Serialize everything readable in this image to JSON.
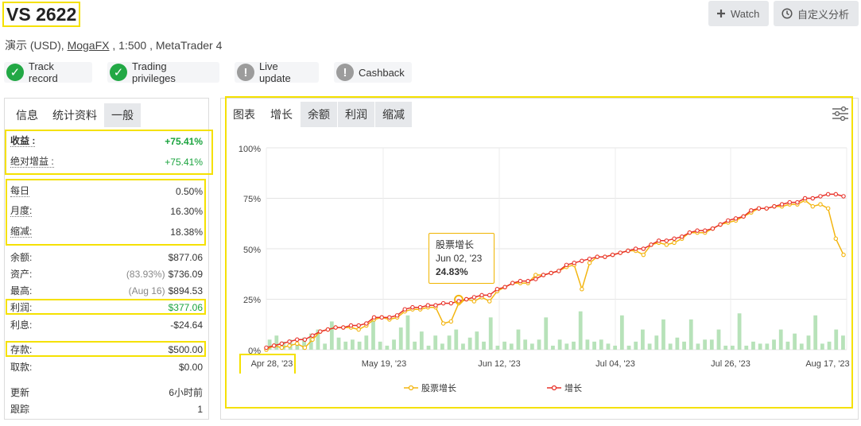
{
  "header": {
    "title": "VS 2622",
    "subtitle_prefix": "演示 (USD), ",
    "broker": "MogaFX",
    "subtitle_suffix": " , 1:500 , MetaTrader 4",
    "watch_label": "Watch",
    "analyze_label": "自定义分析"
  },
  "badges": [
    {
      "label": "Track record",
      "status": "ok"
    },
    {
      "label": "Trading privileges",
      "status": "ok"
    },
    {
      "label": "Live update",
      "status": "warn"
    },
    {
      "label": "Cashback",
      "status": "warn"
    }
  ],
  "left_tabs": [
    "信息",
    "统计资料",
    "一般"
  ],
  "stats": {
    "gain": {
      "label": "收益 :",
      "value": "+75.41%"
    },
    "abs_gain": {
      "label": "绝对增益 :",
      "value": "+75.41%"
    },
    "daily": {
      "label": "每日",
      "value": "0.50%"
    },
    "monthly": {
      "label": "月度:",
      "value": "16.30%"
    },
    "drawdown": {
      "label": "缩减:",
      "value": "18.38%"
    },
    "balance": {
      "label": "余额:",
      "value": "$877.06"
    },
    "equity": {
      "label": "资产:",
      "muted": "(83.93%)",
      "value": "$736.09"
    },
    "highest": {
      "label": "最高:",
      "muted": "(Aug 16)",
      "value": "$894.53"
    },
    "profit": {
      "label": "利润:",
      "value": "$377.06"
    },
    "interest": {
      "label": "利息:",
      "value": "-$24.64"
    },
    "deposits": {
      "label": "存款:",
      "value": "$500.00"
    },
    "withdrawals": {
      "label": "取款:",
      "value": "$0.00"
    },
    "updated": {
      "label": "更新",
      "value": "6小时前"
    },
    "tracking": {
      "label": "跟踪",
      "value": "1"
    }
  },
  "right_tabs": [
    "图表",
    "增长",
    "余额",
    "利润",
    "缩减"
  ],
  "tooltip": {
    "title": "股票增长",
    "date": "Jun 02, '23",
    "value": "24.83%"
  },
  "colors": {
    "growth": "#e8322a",
    "equity": "#f3b511",
    "bars": "#b7e2b9",
    "highlight": "#f5e100",
    "green": "#1aa33e"
  },
  "chart_data": {
    "type": "line",
    "y_ticks": [
      "100%",
      "75%",
      "50%",
      "25%",
      "0%"
    ],
    "ylim": [
      0,
      100
    ],
    "x_tick_labels": [
      "Apr 28, '23",
      "May 19, '23",
      "Jun 12, '23",
      "Jul 04, '23",
      "Jul 26, '23",
      "Aug 17, '23"
    ],
    "legend": [
      "股票增长",
      "增长"
    ],
    "series": [
      {
        "name": "增长",
        "values": [
          1,
          2,
          3,
          4,
          5,
          5,
          7,
          9,
          10,
          11,
          11,
          12,
          12,
          13,
          16,
          16,
          16,
          17,
          20,
          21,
          21,
          22,
          22,
          23,
          23,
          24,
          25,
          26,
          27,
          27,
          30,
          31,
          33,
          34,
          34,
          35,
          37,
          38,
          39,
          42,
          43,
          44,
          45,
          46,
          46,
          47,
          48,
          49,
          50,
          50,
          52,
          54,
          54,
          55,
          56,
          58,
          59,
          59,
          60,
          62,
          64,
          65,
          66,
          69,
          70,
          70,
          71,
          72,
          73,
          73,
          75,
          75,
          76,
          77,
          77,
          76
        ]
      },
      {
        "name": "股票增长",
        "values": [
          0,
          2,
          1,
          2,
          3,
          1,
          5,
          9,
          10,
          11,
          11,
          11,
          10,
          12,
          15,
          16,
          15,
          16,
          19,
          20,
          20,
          21,
          21,
          13,
          14,
          23,
          25,
          24,
          26,
          24,
          29,
          31,
          33,
          33,
          33,
          37,
          37,
          38,
          39,
          41,
          42,
          30,
          43,
          46,
          46,
          47,
          48,
          49,
          49,
          47,
          52,
          53,
          52,
          53,
          55,
          58,
          58,
          58,
          60,
          62,
          63,
          64,
          66,
          68,
          70,
          70,
          71,
          71,
          72,
          72,
          74,
          71,
          72,
          70,
          55,
          47
        ]
      }
    ],
    "bars": [
      5,
      7,
      4,
      5,
      3,
      6,
      8,
      10,
      3,
      14,
      6,
      4,
      5,
      4,
      7,
      15,
      4,
      2,
      5,
      11,
      17,
      4,
      9,
      2,
      7,
      3,
      7,
      10,
      3,
      6,
      9,
      4,
      16,
      2,
      4,
      3,
      10,
      5,
      3,
      5,
      16,
      2,
      5,
      3,
      4,
      19,
      5,
      4,
      5,
      3,
      2,
      17,
      2,
      4,
      10,
      3,
      7,
      15,
      3,
      6,
      4,
      15,
      3,
      5,
      5,
      10,
      2,
      2,
      18,
      2,
      4,
      3,
      3,
      5,
      10,
      4,
      8,
      3,
      7,
      17,
      3,
      4,
      10,
      7
    ]
  }
}
